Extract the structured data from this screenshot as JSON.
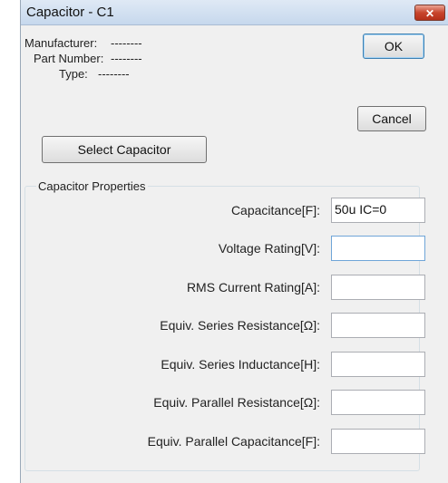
{
  "window": {
    "title": "Capacitor - C1",
    "close_label": "✕"
  },
  "info": {
    "manufacturer_label": "Manufacturer:",
    "manufacturer_value": "--------",
    "part_number_label": "Part Number:",
    "part_number_value": "--------",
    "type_label": "Type:",
    "type_value": "--------"
  },
  "buttons": {
    "ok": "OK",
    "cancel": "Cancel",
    "select": "Select Capacitor"
  },
  "group": {
    "label": "Capacitor Properties"
  },
  "fields": [
    {
      "label": "Capacitance[F]:",
      "value": "50u IC=0"
    },
    {
      "label": "Voltage Rating[V]:",
      "value": ""
    },
    {
      "label": "RMS Current Rating[A]:",
      "value": ""
    },
    {
      "label": "Equiv. Series Resistance[Ω]:",
      "value": ""
    },
    {
      "label": "Equiv. Series Inductance[H]:",
      "value": ""
    },
    {
      "label": "Equiv. Parallel Resistance[Ω]:",
      "value": ""
    },
    {
      "label": "Equiv. Parallel Capacitance[F]:",
      "value": ""
    }
  ]
}
